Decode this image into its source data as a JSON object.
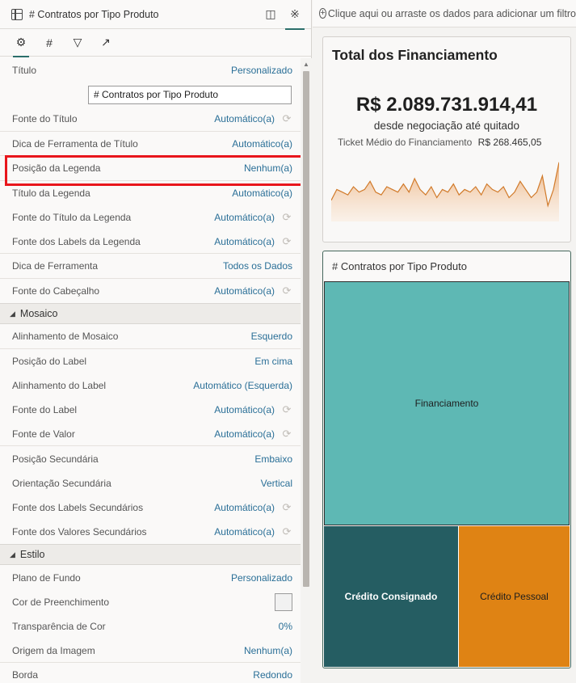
{
  "header": {
    "title": "# Contratos por Tipo Produto"
  },
  "tabs": [
    "settings-icon",
    "number-icon",
    "filter-icon",
    "analytics-icon"
  ],
  "properties": [
    {
      "label": "Título",
      "value": "Personalizado"
    },
    {
      "label": "Fonte do Título",
      "value": "Automático(a)"
    },
    {
      "label": "Dica de Ferramenta de Título",
      "value": "Automático(a)"
    },
    {
      "label": "Posição da Legenda",
      "value": "Nenhum(a)"
    },
    {
      "label": "Título da Legenda",
      "value": "Automático(a)"
    },
    {
      "label": "Fonte do Título da Legenda",
      "value": "Automático(a)"
    },
    {
      "label": "Fonte dos Labels da Legenda",
      "value": "Automático(a)"
    },
    {
      "label": "Dica de Ferramenta",
      "value": "Todos os Dados"
    },
    {
      "label": "Fonte do Cabeçalho",
      "value": "Automático(a)"
    }
  ],
  "title_input_value": "# Contratos por Tipo Produto",
  "sections": {
    "mosaico": {
      "label": "Mosaico",
      "rows": [
        {
          "label": "Alinhamento de Mosaico",
          "value": "Esquerdo"
        },
        {
          "label": "Posição do Label",
          "value": "Em cima"
        },
        {
          "label": "Alinhamento do Label",
          "value": "Automático (Esquerda)"
        },
        {
          "label": "Fonte do Label",
          "value": "Automático(a)"
        },
        {
          "label": "Fonte de Valor",
          "value": "Automático(a)"
        },
        {
          "label": "Posição Secundária",
          "value": "Embaixo"
        },
        {
          "label": "Orientação Secundária",
          "value": "Vertical"
        },
        {
          "label": "Fonte dos Labels Secundários",
          "value": "Automático(a)"
        },
        {
          "label": "Fonte dos Valores Secundários",
          "value": "Automático(a)"
        }
      ]
    },
    "estilo": {
      "label": "Estilo",
      "rows": [
        {
          "label": "Plano de Fundo",
          "value": "Personalizado"
        },
        {
          "label": "Cor de Preenchimento",
          "value": ""
        },
        {
          "label": "Transparência de Cor",
          "value": "0%"
        },
        {
          "label": "Origem da Imagem",
          "value": "Nenhum(a)"
        },
        {
          "label": "Borda",
          "value": "Redondo"
        }
      ]
    }
  },
  "filterbar": {
    "text": "Clique aqui ou arraste os dados para adicionar um filtro"
  },
  "kpi_card": {
    "title": "Total dos Financiamento",
    "value": "R$ 2.089.731.914,41",
    "subtitle": "desde negociação até quitado",
    "ticket_label": "Ticket Médio do Financiamento",
    "ticket_value": "R$ 268.465,05",
    "sparkline": [
      54,
      58,
      57,
      56,
      59,
      57,
      58,
      61,
      57,
      56,
      59,
      58,
      57,
      60,
      57,
      62,
      58,
      56,
      59,
      55,
      58,
      57,
      60,
      56,
      58,
      57,
      59,
      56,
      60,
      58,
      57,
      59,
      55,
      57,
      61,
      58,
      55,
      57,
      63,
      52,
      58,
      68
    ]
  },
  "treemap_card": {
    "title": "# Contratos por Tipo Produto",
    "tiles": [
      {
        "label": "Financiamento",
        "color": "#5eb8b4"
      },
      {
        "label": "Crédito Consignado",
        "color": "#255d62"
      },
      {
        "label": "Crédito Pessoal",
        "color": "#df8314"
      }
    ]
  },
  "colors": {
    "accent": "#2a6f97",
    "highlight": "#e8161c"
  }
}
